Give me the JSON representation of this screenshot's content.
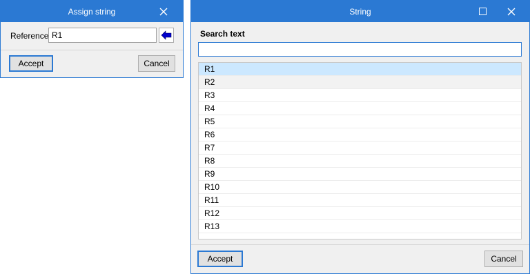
{
  "assign_dialog": {
    "title": "Assign string",
    "reference_label": "Reference",
    "reference_value": "R1",
    "accept_label": "Accept",
    "cancel_label": "Cancel"
  },
  "string_dialog": {
    "title": "String",
    "search_label": "Search text",
    "search_value": "",
    "items": [
      "R1",
      "R2",
      "R3",
      "R4",
      "R5",
      "R6",
      "R7",
      "R8",
      "R9",
      "R10",
      "R11",
      "R12",
      "R13"
    ],
    "selected_index": 0,
    "accept_label": "Accept",
    "cancel_label": "Cancel"
  },
  "colors": {
    "titlebar": "#2b79d3",
    "selection": "#cce8ff",
    "arrow": "#0000cc"
  }
}
